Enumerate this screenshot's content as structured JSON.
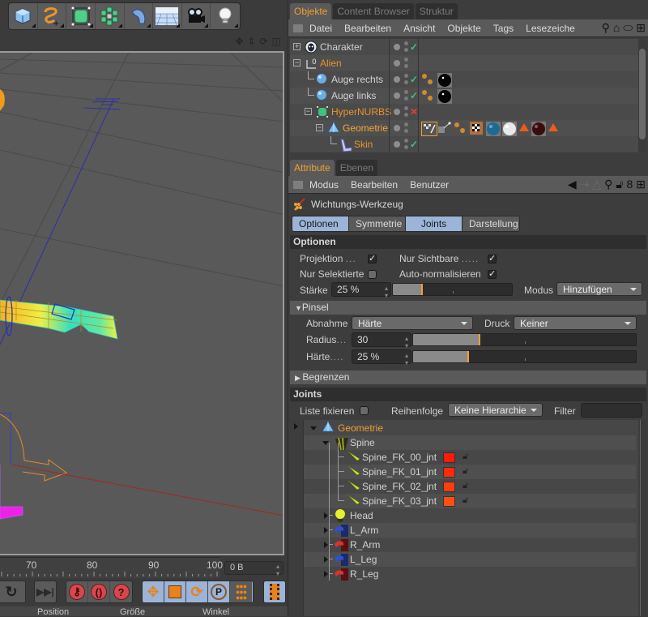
{
  "toolbar": {
    "items": [
      {
        "name": "cube",
        "icon": "cube-icon"
      },
      {
        "name": "spline",
        "icon": "spline-icon"
      },
      {
        "name": "nurbs",
        "icon": "subdivision-cube-icon"
      },
      {
        "name": "array",
        "icon": "array-icon"
      },
      {
        "name": "deformer",
        "icon": "bend-deformer-icon"
      },
      {
        "name": "floor",
        "icon": "floor-grid-icon"
      },
      {
        "name": "camera",
        "icon": "camera-icon"
      },
      {
        "name": "light",
        "icon": "light-bulb-icon"
      }
    ]
  },
  "viewport": {
    "nav_icons": [
      "move-view-icon",
      "dolly-icon",
      "rotate-view-icon",
      "maximize-view-icon"
    ]
  },
  "timeline": {
    "labels": [
      "70",
      "80",
      "90",
      "100"
    ],
    "frame_field": "0 B"
  },
  "transport": {
    "buttons": [
      "loop-icon",
      "go-to-end-icon",
      "record-key-icon",
      "autokey-icon",
      "keyframe-selection-icon",
      "move-key-icon",
      "scale-key-icon",
      "rotate-key-icon",
      "parameter-key-icon",
      "point-level-icon",
      "timeline-icon"
    ]
  },
  "coordinates": {
    "position": "Position",
    "size": "Größe",
    "angle": "Winkel"
  },
  "object_manager": {
    "tabs": [
      {
        "label": "Objekte",
        "active": true
      },
      {
        "label": "Content Browser",
        "active": false
      },
      {
        "label": "Struktur",
        "active": false
      }
    ],
    "menu": [
      "Datei",
      "Bearbeiten",
      "Ansicht",
      "Objekte",
      "Tags",
      "Lesezeiche"
    ],
    "objects": [
      {
        "name": "Charakter",
        "color": "default",
        "icon": "character-icon",
        "expander": "plus",
        "check": "check",
        "tags": []
      },
      {
        "name": "Alien",
        "color": "orange",
        "icon": "null-icon",
        "expander": "minus",
        "check": "",
        "tags": []
      },
      {
        "name": "Auge rechts",
        "color": "default",
        "icon": "sphere-icon",
        "expander": "",
        "check": "check",
        "tags": [
          "constraint-tag-icon",
          "black-material-icon"
        ]
      },
      {
        "name": "Auge links",
        "color": "default",
        "icon": "sphere-icon",
        "expander": "",
        "check": "check",
        "tags": [
          "constraint-tag-icon",
          "black-material-icon"
        ]
      },
      {
        "name": "HyperNURBS",
        "color": "orange",
        "icon": "hypernurbs-icon",
        "expander": "minus",
        "check": "x",
        "tags": []
      },
      {
        "name": "Geometrie",
        "color": "bright",
        "icon": "polygon-icon",
        "expander": "minus",
        "check": "",
        "tags": [
          "weight-tag-icon",
          "uvw-tag-icon",
          "constraint-tag-icon",
          "checker-tag-icon",
          "blue-material-icon",
          "white-material-icon",
          "selection-tag-icon",
          "dark-red-material-icon",
          "selection-tag-icon"
        ]
      },
      {
        "name": "Skin",
        "color": "orange",
        "icon": "skin-icon",
        "expander": "",
        "check": "check",
        "tags": []
      }
    ]
  },
  "attribute_manager": {
    "tabs": [
      {
        "label": "Attribute",
        "active": true
      },
      {
        "label": "Ebenen",
        "active": false
      }
    ],
    "menu": [
      "Modus",
      "Bearbeiten",
      "Benutzer"
    ],
    "tool_name": "Wichtungs-Werkzeug",
    "subtabs": [
      {
        "label": "Optionen",
        "active": true
      },
      {
        "label": "Symmetrie",
        "active": false
      },
      {
        "label": "Joints",
        "active": true
      },
      {
        "label": "Darstellung",
        "active": false
      }
    ],
    "optionen": {
      "header": "Optionen",
      "projektion": {
        "label": "Projektion",
        "checked": true
      },
      "nur_sichtbare": {
        "label": "Nur Sichtbare",
        "checked": true
      },
      "nur_selektierte": {
        "label": "Nur Selektierte",
        "checked": false
      },
      "auto_normalisieren": {
        "label": "Auto-normalisieren",
        "checked": true
      },
      "staerke": {
        "label": "Stärke",
        "value": "25 %",
        "fraction": 0.25
      },
      "modus": {
        "label": "Modus",
        "value": "Hinzufügen"
      }
    },
    "pinsel": {
      "header": "Pinsel",
      "abnahme": {
        "label": "Abnahme",
        "value": "Härte"
      },
      "druck": {
        "label": "Druck",
        "value": "Keiner"
      },
      "radius": {
        "label": "Radius",
        "value": "30",
        "fraction": 0.3
      },
      "haerte": {
        "label": "Härte",
        "value": "25 %",
        "fraction": 0.25
      }
    },
    "begrenzen": {
      "header": "Begrenzen"
    },
    "joints": {
      "header": "Joints",
      "liste_fixieren": {
        "label": "Liste fixieren",
        "checked": false
      },
      "reihenfolge": {
        "label": "Reihenfolge",
        "value": "Keine Hierarchie"
      },
      "filter": {
        "label": "Filter",
        "value": ""
      },
      "tree": [
        {
          "name": "Geometrie",
          "level": 0,
          "icon": "polygon-icon",
          "color": "orange",
          "expander": "down"
        },
        {
          "name": "Spine",
          "level": 1,
          "icon": "spine-icon",
          "color": "default",
          "expander": "down"
        },
        {
          "name": "Spine_FK_00_jnt",
          "level": 2,
          "icon": "joint-icon",
          "color": "default",
          "swatch": "#ff1a0a"
        },
        {
          "name": "Spine_FK_01_jnt",
          "level": 2,
          "icon": "joint-icon",
          "color": "default",
          "swatch": "#ff2a0c"
        },
        {
          "name": "Spine_FK_02_jnt",
          "level": 2,
          "icon": "joint-icon",
          "color": "default",
          "swatch": "#ff3d10"
        },
        {
          "name": "Spine_FK_03_jnt",
          "level": 2,
          "icon": "joint-icon",
          "color": "default",
          "swatch": "#ff5014"
        },
        {
          "name": "Head",
          "level": 1,
          "icon": "head-icon",
          "color": "default",
          "expander": "right"
        },
        {
          "name": "L_Arm",
          "level": 1,
          "icon": "left-arm-icon",
          "color": "default",
          "expander": "right"
        },
        {
          "name": "R_Arm",
          "level": 1,
          "icon": "right-arm-icon",
          "color": "default",
          "expander": "right"
        },
        {
          "name": "L_Leg",
          "level": 1,
          "icon": "left-leg-icon",
          "color": "default",
          "expander": "right"
        },
        {
          "name": "R_Leg",
          "level": 1,
          "icon": "right-leg-icon",
          "color": "default",
          "expander": "right"
        }
      ]
    }
  },
  "colors": {
    "accent": "#f0a030",
    "selected_tab": "#9bb4d8",
    "panel_bg": "#3d3d3d"
  }
}
